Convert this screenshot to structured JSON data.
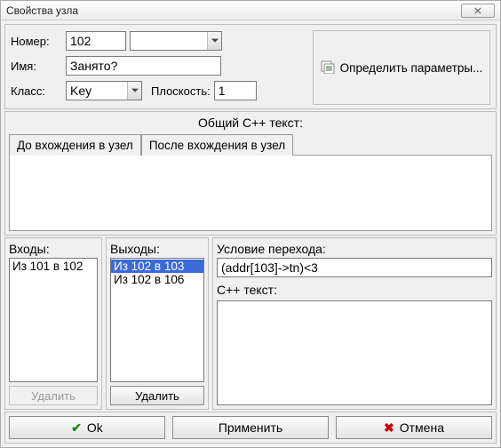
{
  "window": {
    "title": "Свойства узла"
  },
  "labels": {
    "number": "Номер:",
    "name": "Имя:",
    "class": "Класс:",
    "plane": "Плоскость:"
  },
  "fields": {
    "number": "102",
    "name": "Занято?",
    "class": "Key",
    "plane": "1",
    "type": ""
  },
  "define_params": "Определить параметры...",
  "mid": {
    "common_text": "Общий С++ текст:",
    "tab_before": "До вхождения в узел",
    "tab_after": "После вхождения в узел"
  },
  "inputs": {
    "header": "Входы:",
    "items": [
      "Из 101 в 102"
    ],
    "delete": "Удалить"
  },
  "outputs": {
    "header": "Выходы:",
    "items": [
      "Из 102 в 103",
      "Из 102 в 106"
    ],
    "delete": "Удалить"
  },
  "condition": {
    "header": "Условие перехода:",
    "value": "(addr[103]->tn)<3",
    "cpp_text": "С++ текст:"
  },
  "buttons": {
    "ok": "Ok",
    "apply": "Применить",
    "cancel": "Отмена"
  }
}
